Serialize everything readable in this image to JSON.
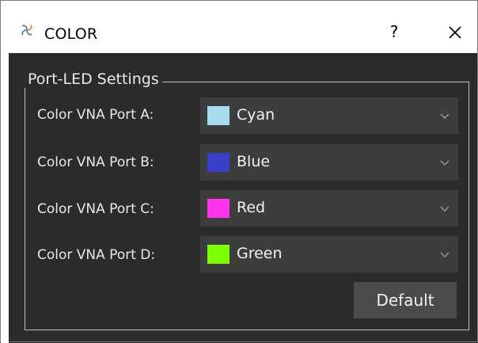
{
  "window": {
    "title": "COLOR",
    "help_label": "?",
    "icons": {
      "app": "swirl-icon",
      "close": "close-icon"
    }
  },
  "group": {
    "title": "Port-LED Settings"
  },
  "ports": [
    {
      "label": "Color VNA Port A:",
      "value": "Cyan",
      "color": "#a7dcee"
    },
    {
      "label": "Color VNA Port B:",
      "value": "Blue",
      "color": "#3a3fc8"
    },
    {
      "label": "Color VNA Port C:",
      "value": "Red",
      "color": "#ff33ee"
    },
    {
      "label": "Color VNA Port D:",
      "value": "Green",
      "color": "#7cff00"
    }
  ],
  "buttons": {
    "default_label": "Default"
  }
}
